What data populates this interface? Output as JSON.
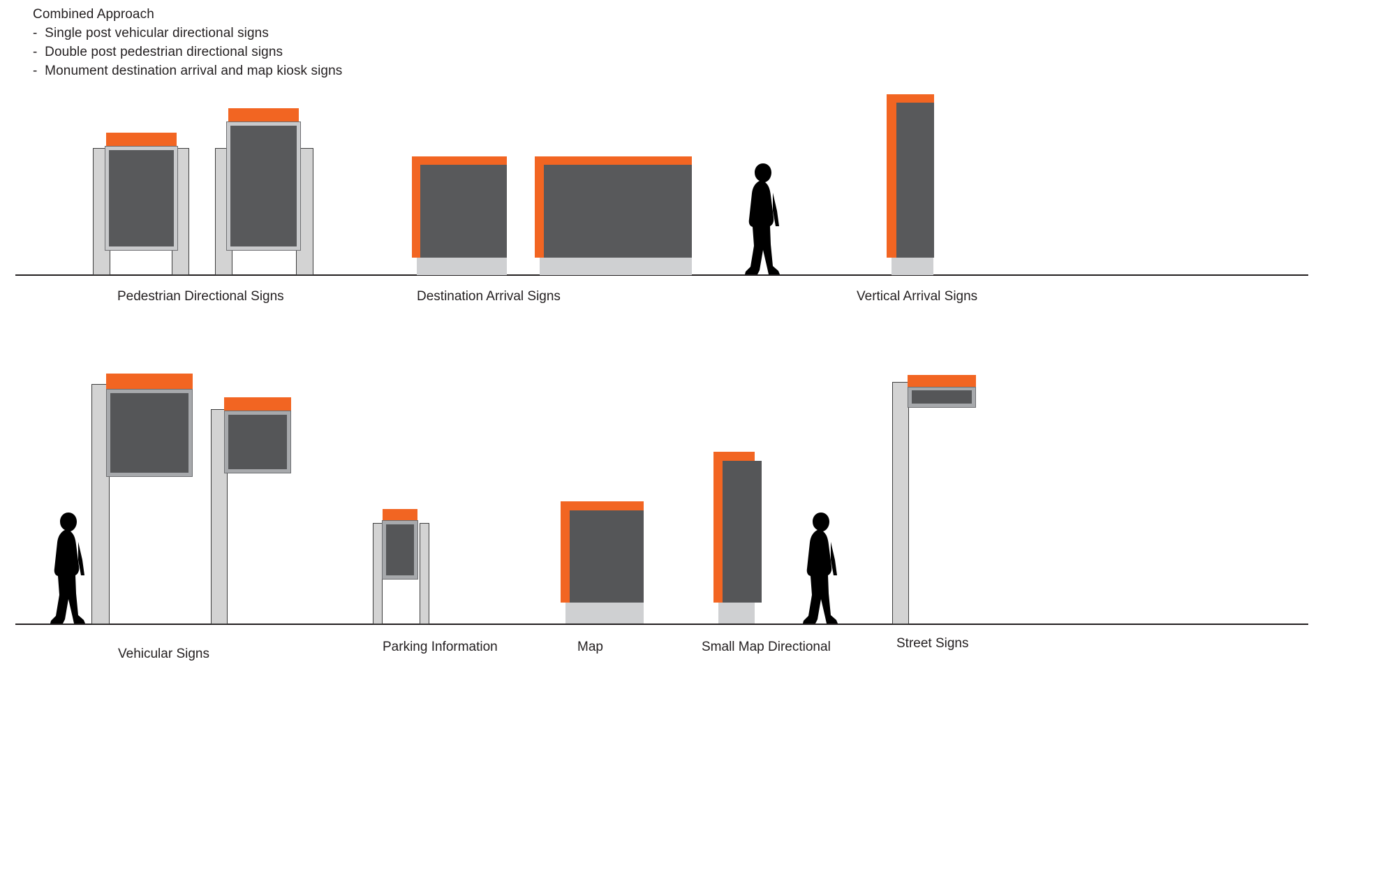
{
  "header": {
    "title": "Combined Approach",
    "bullets": [
      "-  Single post vehicular directional signs",
      "-  Double post pedestrian directional signs",
      "-  Monument destination arrival and map kiosk signs"
    ]
  },
  "colors": {
    "accent_orange": "#F26522",
    "panel_dark_gray": "#58595B",
    "post_light_gray": "#D3D3D3",
    "frame_mid_gray": "#A7A9AC",
    "plinth_gray": "#CFD0D2",
    "text": "#231F20",
    "ground_line": "#231F20",
    "figure_black": "#000000"
  },
  "rows": [
    {
      "name": "upper-row",
      "captions": [
        {
          "label": "Pedestrian Directional Signs"
        },
        {
          "label": "Destination Arrival Signs"
        },
        {
          "label": "Vertical Arrival Signs"
        }
      ]
    },
    {
      "name": "lower-row",
      "captions": [
        {
          "label": "Vehicular Signs"
        },
        {
          "label": "Parking Information"
        },
        {
          "label": "Map"
        },
        {
          "label": "Small Map Directional"
        },
        {
          "label": "Street Signs"
        }
      ]
    }
  ],
  "sign_families": [
    {
      "id": "pedestrian-directional-signs",
      "caption": "Pedestrian Directional Signs",
      "type": "double-post",
      "count": 2,
      "parts": [
        "orange-cap",
        "light-gray-frame",
        "dark-gray-panel",
        "two-light-gray-posts"
      ]
    },
    {
      "id": "destination-arrival-signs",
      "caption": "Destination Arrival Signs",
      "type": "monument",
      "count": 2,
      "parts": [
        "orange-l-edge",
        "dark-gray-panel",
        "light-gray-plinth"
      ]
    },
    {
      "id": "vertical-arrival-signs",
      "caption": "Vertical Arrival Signs",
      "type": "monument-vertical",
      "count": 1,
      "parts": [
        "orange-l-edge",
        "dark-gray-panel",
        "light-gray-plinth"
      ]
    },
    {
      "id": "vehicular-signs",
      "caption": "Vehicular Signs",
      "type": "single-post",
      "count": 2,
      "parts": [
        "orange-cap",
        "mid-gray-frame",
        "dark-gray-panel",
        "single-light-gray-post"
      ]
    },
    {
      "id": "parking-information",
      "caption": "Parking Information",
      "type": "double-post",
      "count": 1,
      "parts": [
        "orange-cap",
        "mid-gray-frame",
        "dark-gray-panel",
        "two-light-gray-posts"
      ]
    },
    {
      "id": "map",
      "caption": "Map",
      "type": "monument",
      "count": 1,
      "parts": [
        "orange-l-edge",
        "dark-gray-panel",
        "light-gray-plinth"
      ]
    },
    {
      "id": "small-map-directional",
      "caption": "Small Map Directional",
      "type": "monument-vertical",
      "count": 1,
      "parts": [
        "orange-l-edge",
        "dark-gray-panel",
        "light-gray-plinth"
      ]
    },
    {
      "id": "street-signs",
      "caption": "Street Signs",
      "type": "single-post-blade",
      "count": 1,
      "parts": [
        "orange-cap",
        "mid-gray-frame",
        "dark-gray-blade",
        "single-light-gray-post"
      ]
    }
  ],
  "figures": [
    {
      "id": "pedestrian-figure-upper",
      "pose": "walking"
    },
    {
      "id": "pedestrian-figure-lower",
      "pose": "walking"
    }
  ]
}
